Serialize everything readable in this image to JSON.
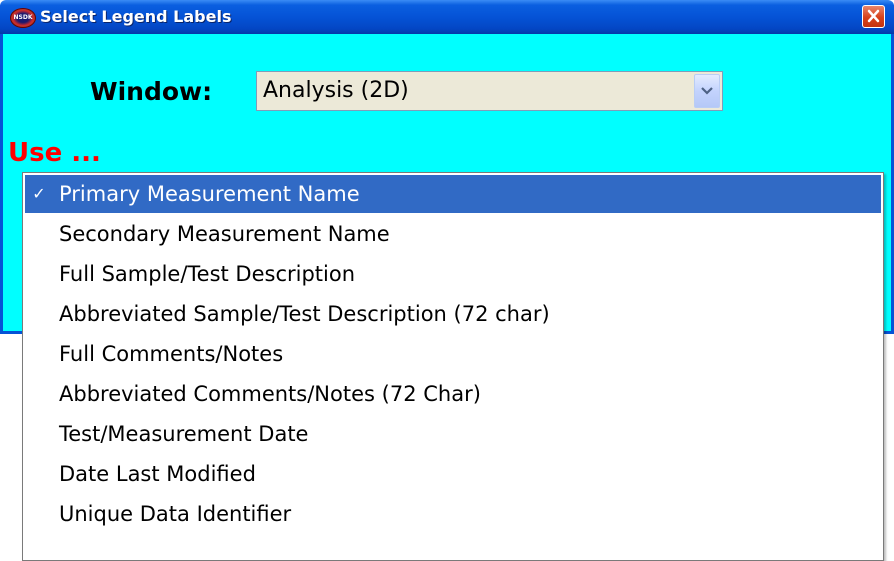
{
  "window": {
    "title": "Select Legend Labels",
    "logo_text": "NSDK"
  },
  "controls": {
    "window_label": "Window:",
    "window_select_value": "Analysis (2D)",
    "use_label": "Use ..."
  },
  "list": {
    "check_mark": "✓",
    "items": [
      {
        "label": "Primary Measurement Name",
        "selected": true
      },
      {
        "label": "Secondary Measurement Name",
        "selected": false
      },
      {
        "label": "Full Sample/Test Description",
        "selected": false
      },
      {
        "label": "Abbreviated Sample/Test Description (72 char)",
        "selected": false
      },
      {
        "label": "Full Comments/Notes",
        "selected": false
      },
      {
        "label": "Abbreviated Comments/Notes (72 Char)",
        "selected": false
      },
      {
        "label": "Test/Measurement Date",
        "selected": false
      },
      {
        "label": "Date Last Modified",
        "selected": false
      },
      {
        "label": "Unique Data Identifier",
        "selected": false
      }
    ]
  },
  "colors": {
    "titlebar": "#0553d6",
    "client_background": "#00ffff",
    "use_label": "#ff0000",
    "selection": "#316ac5"
  }
}
